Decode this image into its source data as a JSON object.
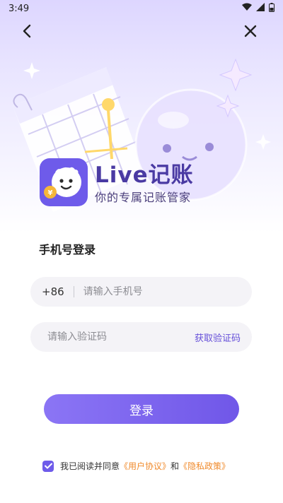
{
  "status_bar": {
    "time": "3:49"
  },
  "brand": {
    "title": "Live记账",
    "subtitle": "你的专属记账管家",
    "logo_badge": "¥"
  },
  "login": {
    "section_title": "手机号登录",
    "country_code": "+86",
    "phone_placeholder": "请输入手机号",
    "code_placeholder": "请输入验证码",
    "get_code_label": "获取验证码",
    "submit_label": "登录"
  },
  "agreement": {
    "checked": true,
    "prefix": "我已阅读并同意",
    "user_agreement": "《用户协议》",
    "conjunction": "和",
    "privacy_policy": "《隐私政策》"
  },
  "icons": {
    "back": "chevron-left-icon",
    "close": "close-icon",
    "wifi": "wifi-icon",
    "signal": "signal-icon",
    "battery": "battery-icon",
    "check": "check-icon"
  },
  "colors": {
    "accent": "#6e5bea",
    "link": "#f08a2b",
    "field_bg": "#f4f3f7",
    "hero_top": "#ddd6ff"
  }
}
